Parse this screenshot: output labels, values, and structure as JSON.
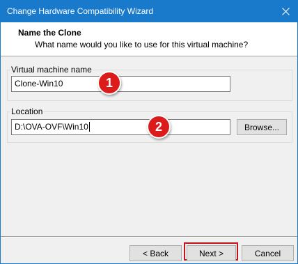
{
  "window": {
    "title": "Change Hardware Compatibility Wizard",
    "accent_color": "#1979ca",
    "close_icon": "close-icon"
  },
  "header": {
    "title": "Name the Clone",
    "subtitle": "What name would you like to use for this virtual machine?"
  },
  "name_group": {
    "label": "Virtual machine name",
    "value": "Clone-Win10"
  },
  "location_group": {
    "label": "Location",
    "value": "D:\\OVA-OVF\\Win10",
    "browse_label": "Browse..."
  },
  "annotations": {
    "badge_1": "1",
    "badge_2": "2",
    "badge_color": "#dc1b1b",
    "highlight_color": "#c0141c"
  },
  "footer": {
    "back_label": "< Back",
    "next_label": "Next >",
    "cancel_label": "Cancel"
  }
}
